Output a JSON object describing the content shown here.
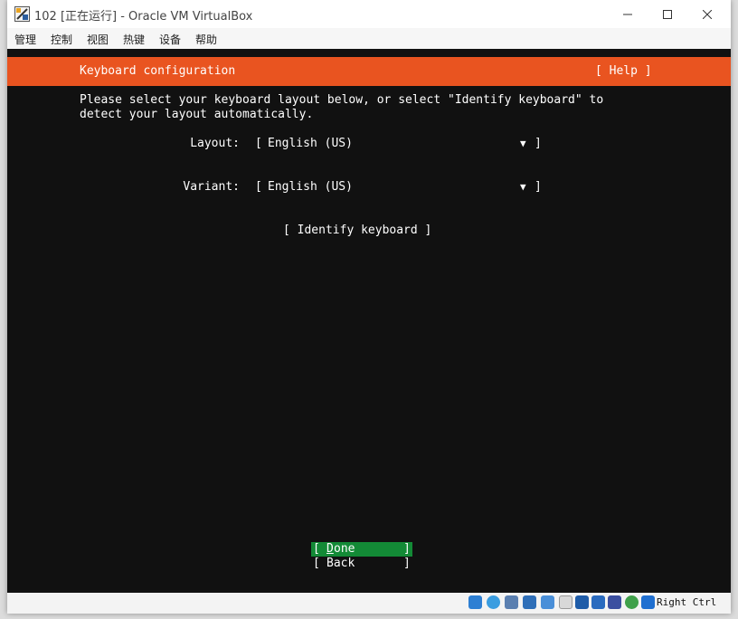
{
  "window": {
    "title": "102 [正在运行] - Oracle VM VirtualBox",
    "controls": {
      "minimize": "—",
      "maximize": "☐",
      "close": "✕"
    }
  },
  "menubar": {
    "items": [
      "管理",
      "控制",
      "视图",
      "热键",
      "设备",
      "帮助"
    ]
  },
  "installer": {
    "header_title": "Keyboard configuration",
    "help_label": "[ Help ]",
    "intro_line1": "Please select your keyboard layout below, or select \"Identify keyboard\" to",
    "intro_line2": "detect your layout automatically.",
    "layout": {
      "label": "Layout:",
      "open": "[",
      "value": "English (US)",
      "arrow": "▼",
      "close": "]"
    },
    "variant": {
      "label": "Variant:",
      "open": "[",
      "value": "English (US)",
      "arrow": "▼",
      "close": "]"
    },
    "identify_label": "[ Identify keyboard ]",
    "done": {
      "open": "[ ",
      "hotkey": "D",
      "rest": "one",
      "close": "]"
    },
    "back": {
      "open": "[ ",
      "label": "Back",
      "close": "]"
    },
    "colors": {
      "accent": "#e95420",
      "background": "#111111",
      "selected": "#138a36"
    }
  },
  "statusbar": {
    "icons": [
      "hard-disk-icon",
      "optical-disk-icon",
      "audio-icon",
      "network-icon",
      "usb-icon",
      "shared-folder-icon",
      "display-icon",
      "recording-icon",
      "vt-x-icon",
      "guest-additions-icon",
      "mouse-integration-icon"
    ],
    "host_key": "Right Ctrl"
  }
}
